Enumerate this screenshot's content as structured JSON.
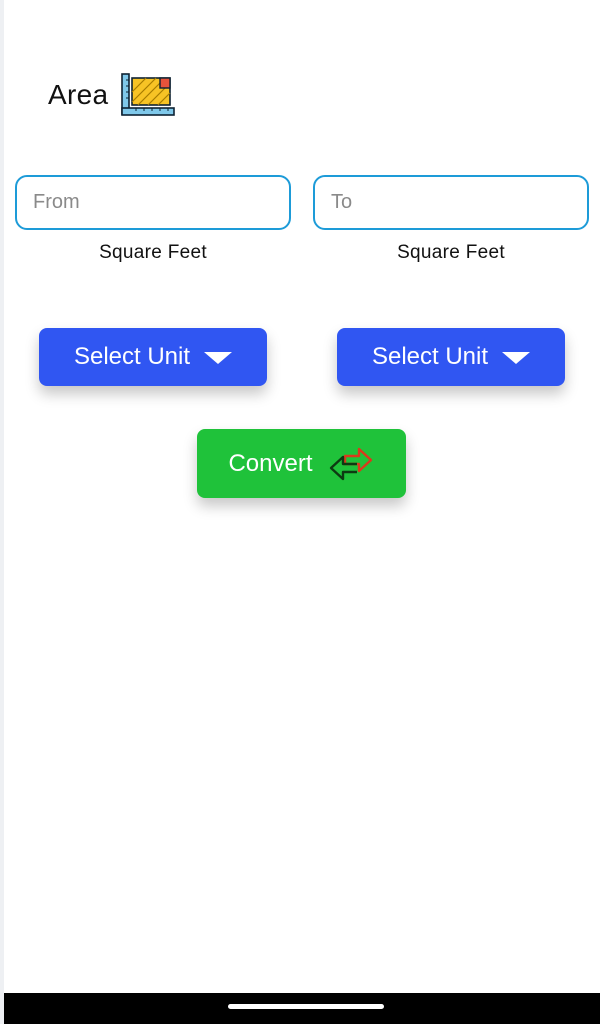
{
  "header": {
    "title": "Area",
    "icon": "area-ruler-icon"
  },
  "from_field": {
    "placeholder": "From",
    "value": "",
    "unit_label": "Square Feet"
  },
  "to_field": {
    "placeholder": "To",
    "value": "",
    "unit_label": "Square Feet"
  },
  "from_unit_select": {
    "label": "Select Unit",
    "icon": "caret-down-icon"
  },
  "to_unit_select": {
    "label": "Select Unit",
    "icon": "caret-down-icon"
  },
  "convert_button": {
    "label": "Convert",
    "icon": "swap-arrows-icon"
  },
  "colors": {
    "field_border": "#1d9bd8",
    "select_button": "#3056f2",
    "convert_button": "#1fc23a",
    "nav_bar": "#000000"
  }
}
